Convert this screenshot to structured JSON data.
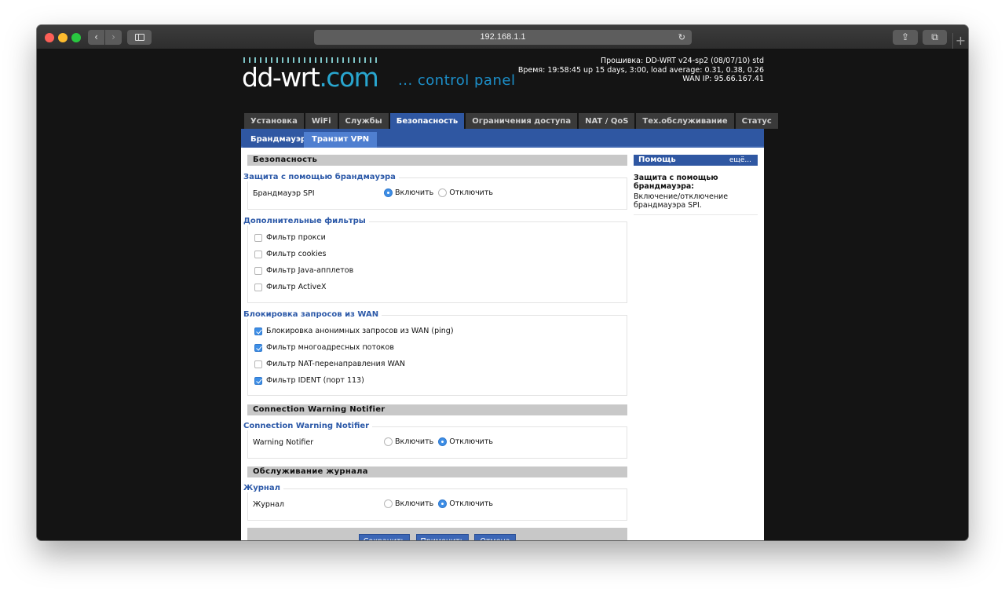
{
  "browser": {
    "url": "192.168.1.1",
    "back_glyph": "‹",
    "forward_glyph": "›",
    "reload_glyph": "↻",
    "share_glyph": "⇪",
    "tabs_glyph": "⧉",
    "plus_glyph": "+"
  },
  "header": {
    "logo_main": "dd-wrt",
    "logo_suffix": ".com",
    "logo_sub": "... control panel",
    "firmware": "Прошивка: DD-WRT v24-sp2 (08/07/10) std",
    "time": "Время: 19:58:45 up 15 days, 3:00, load average: 0.31, 0.38, 0.26",
    "wan_ip": "WAN IP: 95.66.167.41"
  },
  "main_tabs": [
    {
      "label": "Установка"
    },
    {
      "label": "WiFi"
    },
    {
      "label": "Службы"
    },
    {
      "label": "Безопасность"
    },
    {
      "label": "Ограничения доступа"
    },
    {
      "label": "NAT / QoS"
    },
    {
      "label": "Тех.обслуживание"
    },
    {
      "label": "Статус"
    }
  ],
  "active_main_tab": "Безопасность",
  "sub_tabs": [
    {
      "label": "Брандмауэр"
    },
    {
      "label": "Транзит VPN"
    }
  ],
  "sections": {
    "security": {
      "title": "Безопасность",
      "firewall_legend": "Защита с помощью брандмауэра",
      "spi_label": "Брандмауэр SPI",
      "spi_value": "Включить",
      "enable": "Включить",
      "disable": "Отключить",
      "filters_legend": "Дополнительные фильтры",
      "filters": [
        {
          "label": "Фильтр прокси",
          "checked": false
        },
        {
          "label": "Фильтр cookies",
          "checked": false
        },
        {
          "label": "Фильтр Java-апплетов",
          "checked": false
        },
        {
          "label": "Фильтр ActiveX",
          "checked": false
        }
      ],
      "wan_legend": "Блокировка запросов из WAN",
      "wan_filters": [
        {
          "label": "Блокировка анонимных запросов из WAN (ping)",
          "checked": true
        },
        {
          "label": "Фильтр многоадресных потоков",
          "checked": true
        },
        {
          "label": "Фильтр NAT-перенаправления WAN",
          "checked": false
        },
        {
          "label": "Фильтр IDENT (порт 113)",
          "checked": true
        }
      ]
    },
    "warning": {
      "title": "Connection Warning Notifier",
      "legend": "Connection Warning Notifier",
      "label": "Warning Notifier",
      "enable": "Включить",
      "disable": "Отключить",
      "value": "Отключить"
    },
    "log": {
      "title": "Обслуживание журнала",
      "legend": "Журнал",
      "label": "Журнал",
      "enable": "Включить",
      "disable": "Отключить",
      "value": "Отключить"
    }
  },
  "buttons": {
    "save": "Сохранить",
    "apply": "Применить",
    "cancel": "Отмена"
  },
  "help": {
    "title": "Помощь",
    "more": "ещё...",
    "topic": "Защита с помощью брандмауэра:",
    "text": "Включение/отключение брандмауэра SPI."
  },
  "colors": {
    "accent": "#2f57a2",
    "legend_text": "#2c59a8",
    "checked": "#3d8ee6"
  }
}
